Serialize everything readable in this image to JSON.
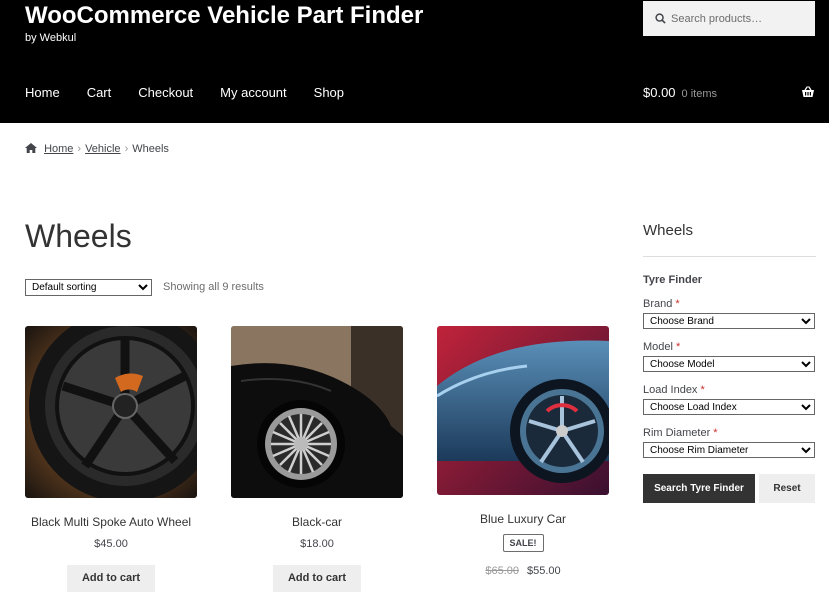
{
  "site": {
    "title": "WooCommerce Vehicle Part Finder",
    "tagline": "by Webkul"
  },
  "search": {
    "placeholder": "Search products…"
  },
  "nav": [
    "Home",
    "Cart",
    "Checkout",
    "My account",
    "Shop"
  ],
  "cart": {
    "total": "$0.00",
    "count": "0 items"
  },
  "breadcrumb": {
    "home": "Home",
    "category": "Vehicle",
    "current": "Wheels"
  },
  "page": {
    "title": "Wheels",
    "result_count": "Showing all 9 results"
  },
  "sorting": {
    "selected": "Default sorting"
  },
  "products": [
    {
      "name": "Black Multi Spoke Auto Wheel",
      "price": "$45.00",
      "button": "Add to cart"
    },
    {
      "name": "Black-car",
      "price": "$18.00",
      "button": "Add to cart"
    },
    {
      "name": "Blue Luxury Car",
      "sale_badge": "SALE!",
      "old_price": "$65.00",
      "price": "$55.00"
    }
  ],
  "sidebar": {
    "widget_title": "Wheels",
    "finder_title": "Tyre Finder",
    "fields": [
      {
        "label": "Brand",
        "required": "*",
        "selected": "Choose Brand"
      },
      {
        "label": "Model",
        "required": "*",
        "selected": "Choose Model"
      },
      {
        "label": "Load Index",
        "required": "*",
        "selected": "Choose Load Index"
      },
      {
        "label": "Rim Diameter",
        "required": "*",
        "selected": "Choose Rim Diameter"
      }
    ],
    "search_button": "Search Tyre Finder",
    "reset_button": "Reset"
  },
  "colors": {
    "header_bg": "#000000",
    "button_dark": "#333333",
    "button_light": "#eeeeee",
    "required": "#c9302c"
  }
}
